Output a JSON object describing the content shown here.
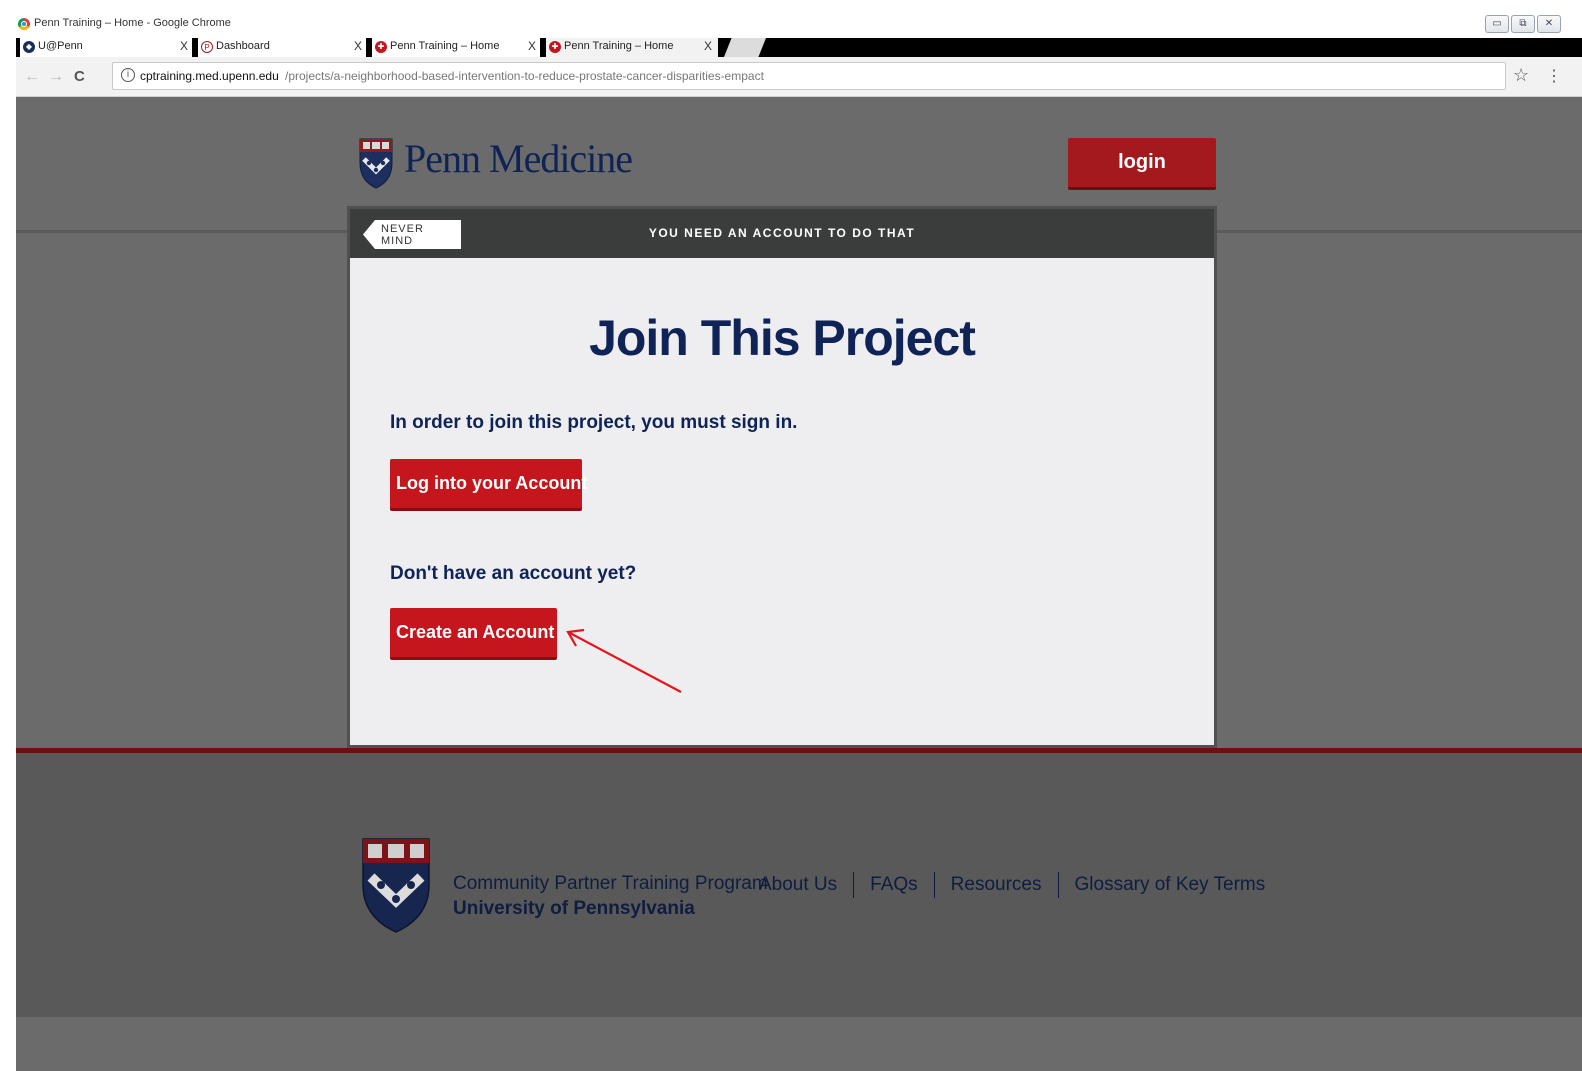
{
  "window": {
    "title": "Penn Training – Home - Google Chrome",
    "minimize_glyph": "▭",
    "maximize_glyph": "⧉",
    "close_glyph": "✕"
  },
  "tabs": [
    {
      "label": "U@Penn",
      "close": "X",
      "favicon": "penn-shield-icon"
    },
    {
      "label": "Dashboard",
      "close": "X",
      "favicon": "p-logo-icon"
    },
    {
      "label": "Penn Training – Home",
      "close": "X",
      "favicon": "penn-globe-icon"
    },
    {
      "label": "Penn Training – Home",
      "close": "X",
      "favicon": "penn-globe-icon",
      "active": true
    }
  ],
  "toolbar": {
    "back_glyph": "←",
    "forward_glyph": "→",
    "reload_glyph": "C",
    "info_glyph": "i",
    "url_domain": "cptraining.med.upenn.edu",
    "url_path": "/projects/a-neighborhood-based-intervention-to-reduce-prostate-cancer-disparities-empact",
    "star_glyph": "☆",
    "menu_glyph": "⋮"
  },
  "header": {
    "brand": "Penn Medicine",
    "login_label": "login"
  },
  "modal": {
    "back_label": "NEVER MIND",
    "header_text": "YOU NEED AN ACCOUNT TO DO THAT",
    "title": "Join This Project",
    "instruction": "In order to join this project, you must sign in.",
    "login_button": "Log into your Account",
    "no_account_text": "Don't have an account yet?",
    "create_button": "Create an Account"
  },
  "footer": {
    "program": "Community Partner Training Program",
    "university": "University of Pennsylvania",
    "links": [
      "About Us",
      "FAQs",
      "Resources",
      "Glossary of Key Terms"
    ]
  },
  "colors": {
    "penn_red": "#c4161c",
    "penn_navy": "#0f2356",
    "overlay_gray": "#6b6b6b",
    "annotation_arrow": "#e8141c"
  }
}
